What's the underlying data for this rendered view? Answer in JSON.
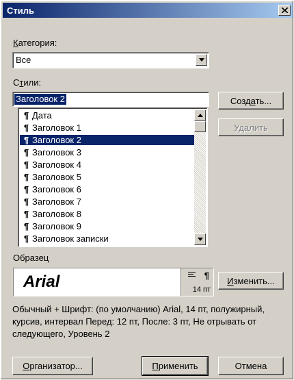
{
  "window": {
    "title": "Стиль"
  },
  "category": {
    "label": "Категория:",
    "value": "Все"
  },
  "styles": {
    "label": "Стили:",
    "input_value": "Заголовок 2",
    "pilcrow": "¶",
    "items": [
      {
        "label": "Дата",
        "selected": false
      },
      {
        "label": "Заголовок 1",
        "selected": false
      },
      {
        "label": "Заголовок 2",
        "selected": true
      },
      {
        "label": "Заголовок 3",
        "selected": false
      },
      {
        "label": "Заголовок 4",
        "selected": false
      },
      {
        "label": "Заголовок 5",
        "selected": false
      },
      {
        "label": "Заголовок 6",
        "selected": false
      },
      {
        "label": "Заголовок 7",
        "selected": false
      },
      {
        "label": "Заголовок 8",
        "selected": false
      },
      {
        "label": "Заголовок 9",
        "selected": false
      },
      {
        "label": "Заголовок записки",
        "selected": false
      }
    ]
  },
  "buttons": {
    "create": "Создать...",
    "delete": "Удалить",
    "modify": "Изменить...",
    "organizer": "Организатор...",
    "apply": "Применить",
    "cancel": "Отмена"
  },
  "sample": {
    "label": "Образец",
    "font_preview": "Arial",
    "size": "14 пт",
    "pilcrow": "¶"
  },
  "description": "Обычный + Шрифт: (по умолчанию) Arial, 14 пт, полужирный, курсив, интервал Перед:  12 пт, После:  3 пт, Не отрывать от следующего, Уровень 2",
  "colors": {
    "title_start": "#0a246a",
    "title_end": "#a6caf0",
    "selection": "#0a246a",
    "face": "#d4d0c8"
  }
}
